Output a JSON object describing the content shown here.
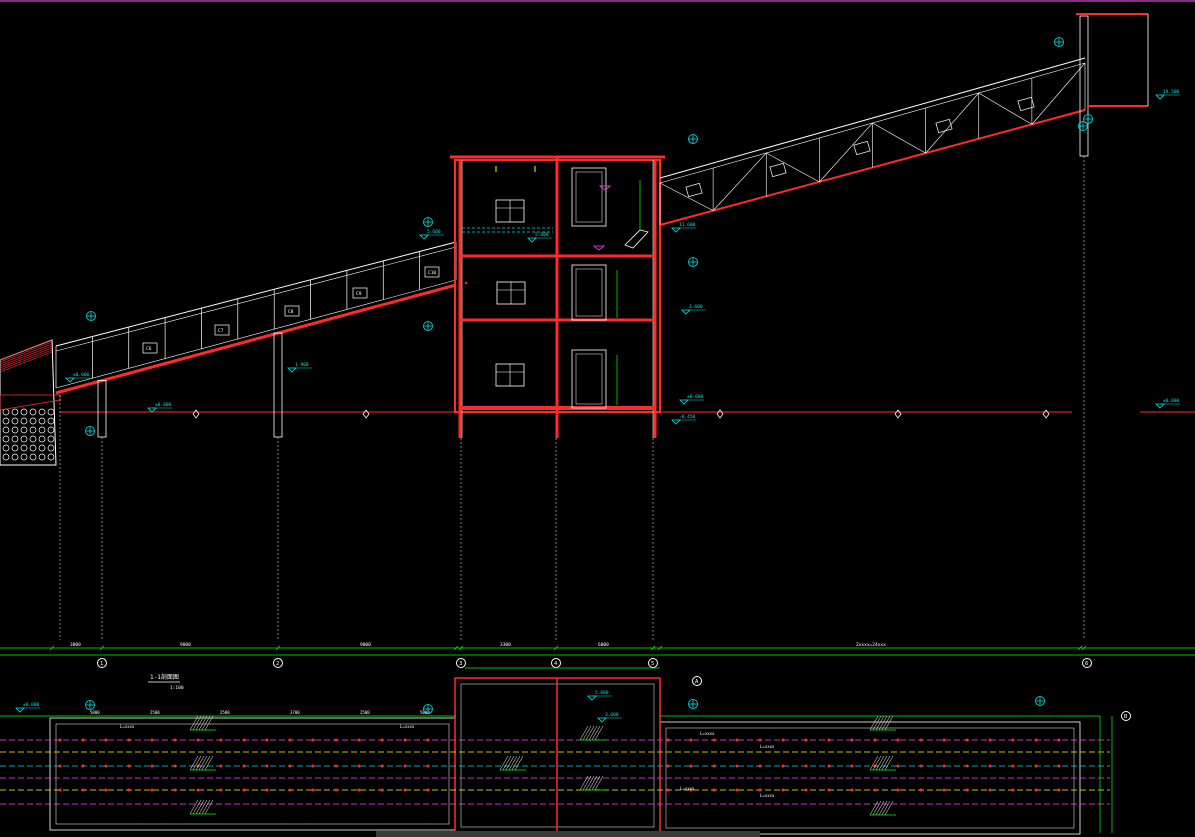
{
  "drawing": {
    "section_title": "1-1剖面图",
    "scale_text": "1:100",
    "grid_labels": [
      "1",
      "2",
      "3",
      "4",
      "5",
      "6"
    ],
    "plan_axis_labels": [
      "A",
      "B"
    ],
    "dimension_texts": [
      "3000",
      "9000",
      "3300",
      "6000",
      "2xxxx=24xxx",
      "5000",
      "2500",
      "3700",
      "2500",
      "2200",
      "3500",
      "4500"
    ],
    "elevation_tags": [
      "±0.000",
      "3.600",
      "7.200",
      "11.600",
      "-0.450",
      "1.900",
      "5.600",
      "19.500"
    ],
    "conveyor_tags": [
      "C6",
      "C7",
      "C8",
      "C9",
      "C10",
      "C11"
    ],
    "plan_texts": [
      "L=xxxx",
      "L=xxxx",
      "L=xxxx",
      "L=xxxx",
      "L=xxxx",
      "L=xxxx"
    ],
    "colors": {
      "background": "#000000",
      "structure_red": "#ff2a2a",
      "line_white": "#ffffff",
      "cyan": "#00e0e0",
      "green": "#00ff00",
      "magenta": "#ff40ff",
      "yellow": "#ffff00"
    }
  }
}
